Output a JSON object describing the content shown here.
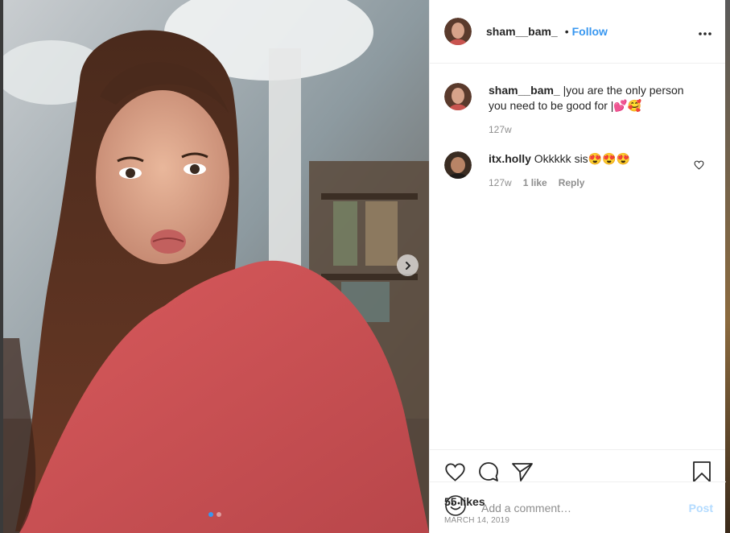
{
  "post": {
    "author": "sham__bam_",
    "separator": "•",
    "follow_label": "Follow",
    "more_label": "•••",
    "carousel": {
      "slide_count": 2,
      "active_slide": 1
    }
  },
  "comments": [
    {
      "user": "sham__bam_",
      "text": "|you are the only person you need to be good for |💕🥰",
      "time": "127w"
    },
    {
      "user": "itx.holly",
      "text": "Okkkkk sis😍😍😍",
      "time": "127w",
      "likes": "1 like",
      "reply_label": "Reply"
    }
  ],
  "stats": {
    "likes": "55 likes",
    "date": "MARCH 14, 2019"
  },
  "composer": {
    "placeholder": "Add a comment…",
    "post_label": "Post"
  },
  "colors": {
    "accent": "#3897f0",
    "text": "#262626",
    "muted": "#8e8e8e",
    "post_disabled": "#b3dbff"
  }
}
